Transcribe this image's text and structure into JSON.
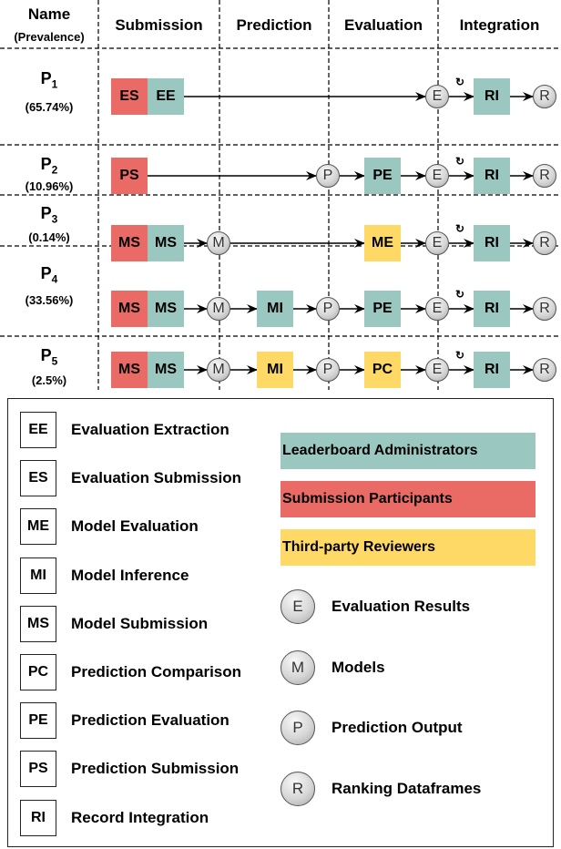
{
  "colors": {
    "admin": "#9ac8c0",
    "participant": "#ea6b66",
    "reviewer": "#ffd966",
    "line": "#000000"
  },
  "header": {
    "name": "Name",
    "prevalence": "(Prevalence)",
    "stages": [
      "Submission",
      "Prediction",
      "Evaluation",
      "Integration"
    ]
  },
  "patterns": [
    {
      "name": "P",
      "sub": "1",
      "prevalence": "(65.74%)",
      "nodes": [
        {
          "type": "box",
          "label": "ES",
          "role": "participant",
          "slot": "s1"
        },
        {
          "type": "box",
          "label": "EE",
          "role": "admin",
          "slot": "s2"
        },
        {
          "type": "circle",
          "label": "E",
          "slot": "e"
        },
        {
          "type": "box",
          "label": "RI",
          "role": "admin",
          "slot": "ri"
        },
        {
          "type": "circle",
          "label": "R",
          "slot": "r"
        }
      ]
    },
    {
      "name": "P",
      "sub": "2",
      "prevalence": "(10.96%)",
      "nodes": [
        {
          "type": "box",
          "label": "PS",
          "role": "participant",
          "slot": "s1"
        },
        {
          "type": "circle",
          "label": "P",
          "slot": "p"
        },
        {
          "type": "box",
          "label": "PE",
          "role": "admin",
          "slot": "ev"
        },
        {
          "type": "circle",
          "label": "E",
          "slot": "e"
        },
        {
          "type": "box",
          "label": "RI",
          "role": "admin",
          "slot": "ri"
        },
        {
          "type": "circle",
          "label": "R",
          "slot": "r"
        }
      ]
    },
    {
      "name": "P",
      "sub": "3",
      "prevalence": "(0.14%)",
      "nodes": [
        {
          "type": "box",
          "label": "MS",
          "role": "participant",
          "slot": "s1"
        },
        {
          "type": "box",
          "label": "MS",
          "role": "admin",
          "slot": "s2"
        },
        {
          "type": "circle",
          "label": "M",
          "slot": "m"
        },
        {
          "type": "box",
          "label": "ME",
          "role": "reviewer",
          "slot": "ev"
        },
        {
          "type": "circle",
          "label": "E",
          "slot": "e"
        },
        {
          "type": "box",
          "label": "RI",
          "role": "admin",
          "slot": "ri"
        },
        {
          "type": "circle",
          "label": "R",
          "slot": "r"
        }
      ]
    },
    {
      "name": "P",
      "sub": "4",
      "prevalence": "(33.56%)",
      "nodes": [
        {
          "type": "box",
          "label": "MS",
          "role": "participant",
          "slot": "s1"
        },
        {
          "type": "box",
          "label": "MS",
          "role": "admin",
          "slot": "s2"
        },
        {
          "type": "circle",
          "label": "M",
          "slot": "m"
        },
        {
          "type": "box",
          "label": "MI",
          "role": "admin",
          "slot": "mi"
        },
        {
          "type": "circle",
          "label": "P",
          "slot": "p"
        },
        {
          "type": "box",
          "label": "PE",
          "role": "admin",
          "slot": "ev"
        },
        {
          "type": "circle",
          "label": "E",
          "slot": "e"
        },
        {
          "type": "box",
          "label": "RI",
          "role": "admin",
          "slot": "ri"
        },
        {
          "type": "circle",
          "label": "R",
          "slot": "r"
        }
      ]
    },
    {
      "name": "P",
      "sub": "5",
      "prevalence": "(2.5%)",
      "nodes": [
        {
          "type": "box",
          "label": "MS",
          "role": "participant",
          "slot": "s1"
        },
        {
          "type": "box",
          "label": "MS",
          "role": "admin",
          "slot": "s2"
        },
        {
          "type": "circle",
          "label": "M",
          "slot": "m"
        },
        {
          "type": "box",
          "label": "MI",
          "role": "reviewer",
          "slot": "mi"
        },
        {
          "type": "circle",
          "label": "P",
          "slot": "p"
        },
        {
          "type": "box",
          "label": "PC",
          "role": "reviewer",
          "slot": "ev"
        },
        {
          "type": "circle",
          "label": "E",
          "slot": "e"
        },
        {
          "type": "box",
          "label": "RI",
          "role": "admin",
          "slot": "ri"
        },
        {
          "type": "circle",
          "label": "R",
          "slot": "r"
        }
      ]
    }
  ],
  "legend": {
    "abbreviations": [
      {
        "abbr": "EE",
        "text": "Evaluation Extraction"
      },
      {
        "abbr": "ES",
        "text": "Evaluation Submission"
      },
      {
        "abbr": "ME",
        "text": "Model Evaluation"
      },
      {
        "abbr": "MI",
        "text": "Model Inference"
      },
      {
        "abbr": "MS",
        "text": "Model Submission"
      },
      {
        "abbr": "PC",
        "text": "Prediction Comparison"
      },
      {
        "abbr": "PE",
        "text": "Prediction Evaluation"
      },
      {
        "abbr": "PS",
        "text": "Prediction Submission"
      },
      {
        "abbr": "RI",
        "text": "Record Integration"
      }
    ],
    "roles": [
      {
        "text": "Leaderboard Administrators",
        "role": "admin"
      },
      {
        "text": "Submission Participants",
        "role": "participant"
      },
      {
        "text": "Third-party Reviewers",
        "role": "reviewer"
      }
    ],
    "artifacts": [
      {
        "symbol": "E",
        "text": "Evaluation Results"
      },
      {
        "symbol": "M",
        "text": "Models"
      },
      {
        "symbol": "P",
        "text": "Prediction Output"
      },
      {
        "symbol": "R",
        "text": "Ranking Dataframes"
      }
    ]
  }
}
